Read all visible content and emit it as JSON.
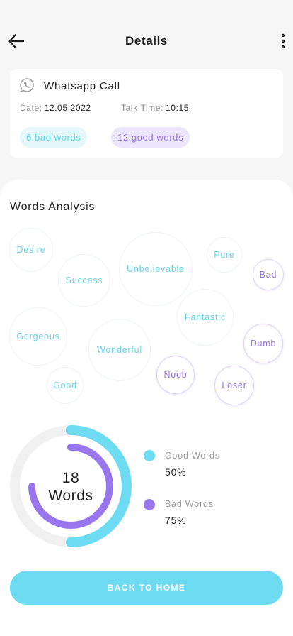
{
  "header": {
    "title": "Details",
    "back_icon": "arrow-left-icon",
    "menu_icon": "more-vertical-icon"
  },
  "call": {
    "icon": "whatsapp-icon",
    "title": "Whatsapp Call",
    "date_label": "Date:",
    "date_value": "12.05.2022",
    "talk_label": "Talk Time:",
    "talk_value": "10:15",
    "bad_words_chip": "6 bad words",
    "good_words_chip": "12 good words"
  },
  "analysis": {
    "title": "Words Analysis",
    "words": [
      {
        "text": "Desire",
        "kind": "good"
      },
      {
        "text": "Success",
        "kind": "good"
      },
      {
        "text": "Unbelievable",
        "kind": "good"
      },
      {
        "text": "Pure",
        "kind": "good"
      },
      {
        "text": "Bad",
        "kind": "bad"
      },
      {
        "text": "Fantastic",
        "kind": "good"
      },
      {
        "text": "Gorgeous",
        "kind": "good"
      },
      {
        "text": "Wonderful",
        "kind": "good"
      },
      {
        "text": "Dumb",
        "kind": "bad"
      },
      {
        "text": "Noob",
        "kind": "bad"
      },
      {
        "text": "Loser",
        "kind": "bad"
      },
      {
        "text": "Good",
        "kind": "good"
      }
    ]
  },
  "summary": {
    "total_number": "18",
    "total_label": "Words",
    "good_label": "Good Words",
    "good_value": "50%",
    "bad_label": "Bad Words",
    "bad_value": "75%",
    "good_fraction": 0.5,
    "bad_fraction": 0.75,
    "good_color": "#6ddcf2",
    "bad_color": "#9a76ee",
    "track_color": "#f0f0f0"
  },
  "footer": {
    "button_label": "BACK TO HOME"
  }
}
